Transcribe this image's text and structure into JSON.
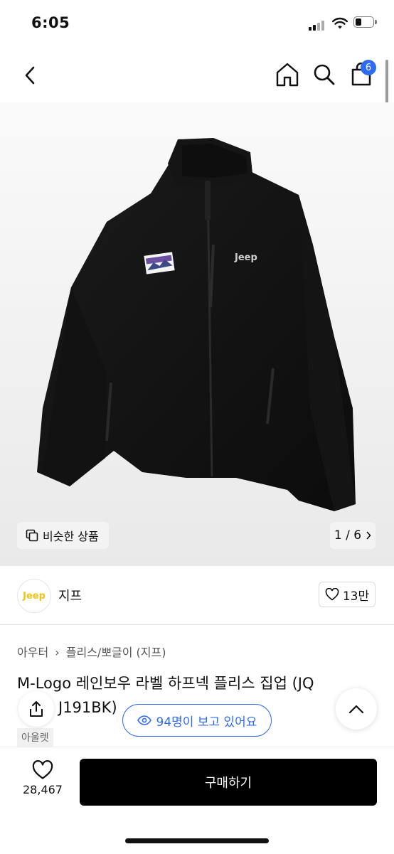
{
  "status": {
    "time": "6:05"
  },
  "nav": {
    "cart_badge": "6"
  },
  "gallery": {
    "similar_label": "비슷한 상품",
    "counter": "1 / 6"
  },
  "brand": {
    "logo_text": "Jeep",
    "name": "지프",
    "likes": "13만"
  },
  "product": {
    "breadcrumb_category": "아우터",
    "breadcrumb_sub": "플리스/뽀글이 (지프)",
    "title_line1": "M-Logo 레인보우 라벨 하프넥 플리스 집업 (JQ",
    "title_line2": "J191BK)",
    "tag": "아울렛",
    "viewers": "94명이 보고 있어요"
  },
  "bottom": {
    "wish_count": "28,467",
    "buy_label": "구매하기"
  },
  "colors": {
    "accent": "#2f6bf2",
    "brand_yellow": "#f0c419"
  }
}
